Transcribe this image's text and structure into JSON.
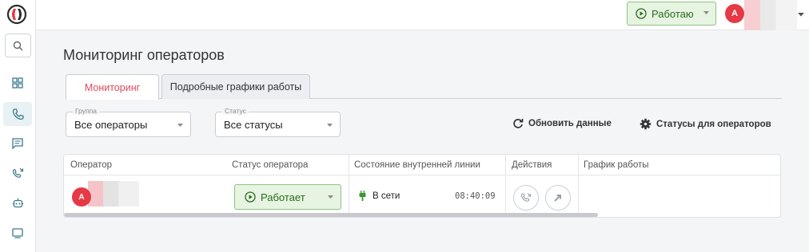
{
  "colors": {
    "accent": "#e0495a",
    "work_green": "#2a6b1e",
    "work_green_bg": "#e6f4e1",
    "avatar_red": "#e53945",
    "icon_teal": "#3d7a8c"
  },
  "header": {
    "work_button_label": "Работаю",
    "user_initial": "А"
  },
  "page": {
    "title": "Мониторинг операторов"
  },
  "tabs": [
    {
      "label": "Мониторинг",
      "active": true
    },
    {
      "label": "Подробные графики работы",
      "active": false
    }
  ],
  "filters": {
    "group": {
      "legend": "Группа",
      "value": "Все операторы"
    },
    "status": {
      "legend": "Статус",
      "value": "Все статусы"
    }
  },
  "actions": {
    "refresh": "Обновить данные",
    "statuses": "Статусы для операторов"
  },
  "table": {
    "columns": [
      "Оператор",
      "Статус оператора",
      "Состояние внутренней линии",
      "Действия",
      "График работы"
    ],
    "rows": [
      {
        "operator_initial": "А",
        "status": "Работает",
        "line_state": "В сети",
        "line_time": "08:40:09"
      }
    ]
  },
  "icons": [
    "logo-icon",
    "search-icon",
    "dashboard-icon",
    "phone-icon",
    "chat-icon",
    "callback-icon",
    "bot-icon",
    "message-icon",
    "play-circle-icon",
    "refresh-icon",
    "gear-icon",
    "plug-icon",
    "transfer-call-icon",
    "redirect-icon"
  ]
}
